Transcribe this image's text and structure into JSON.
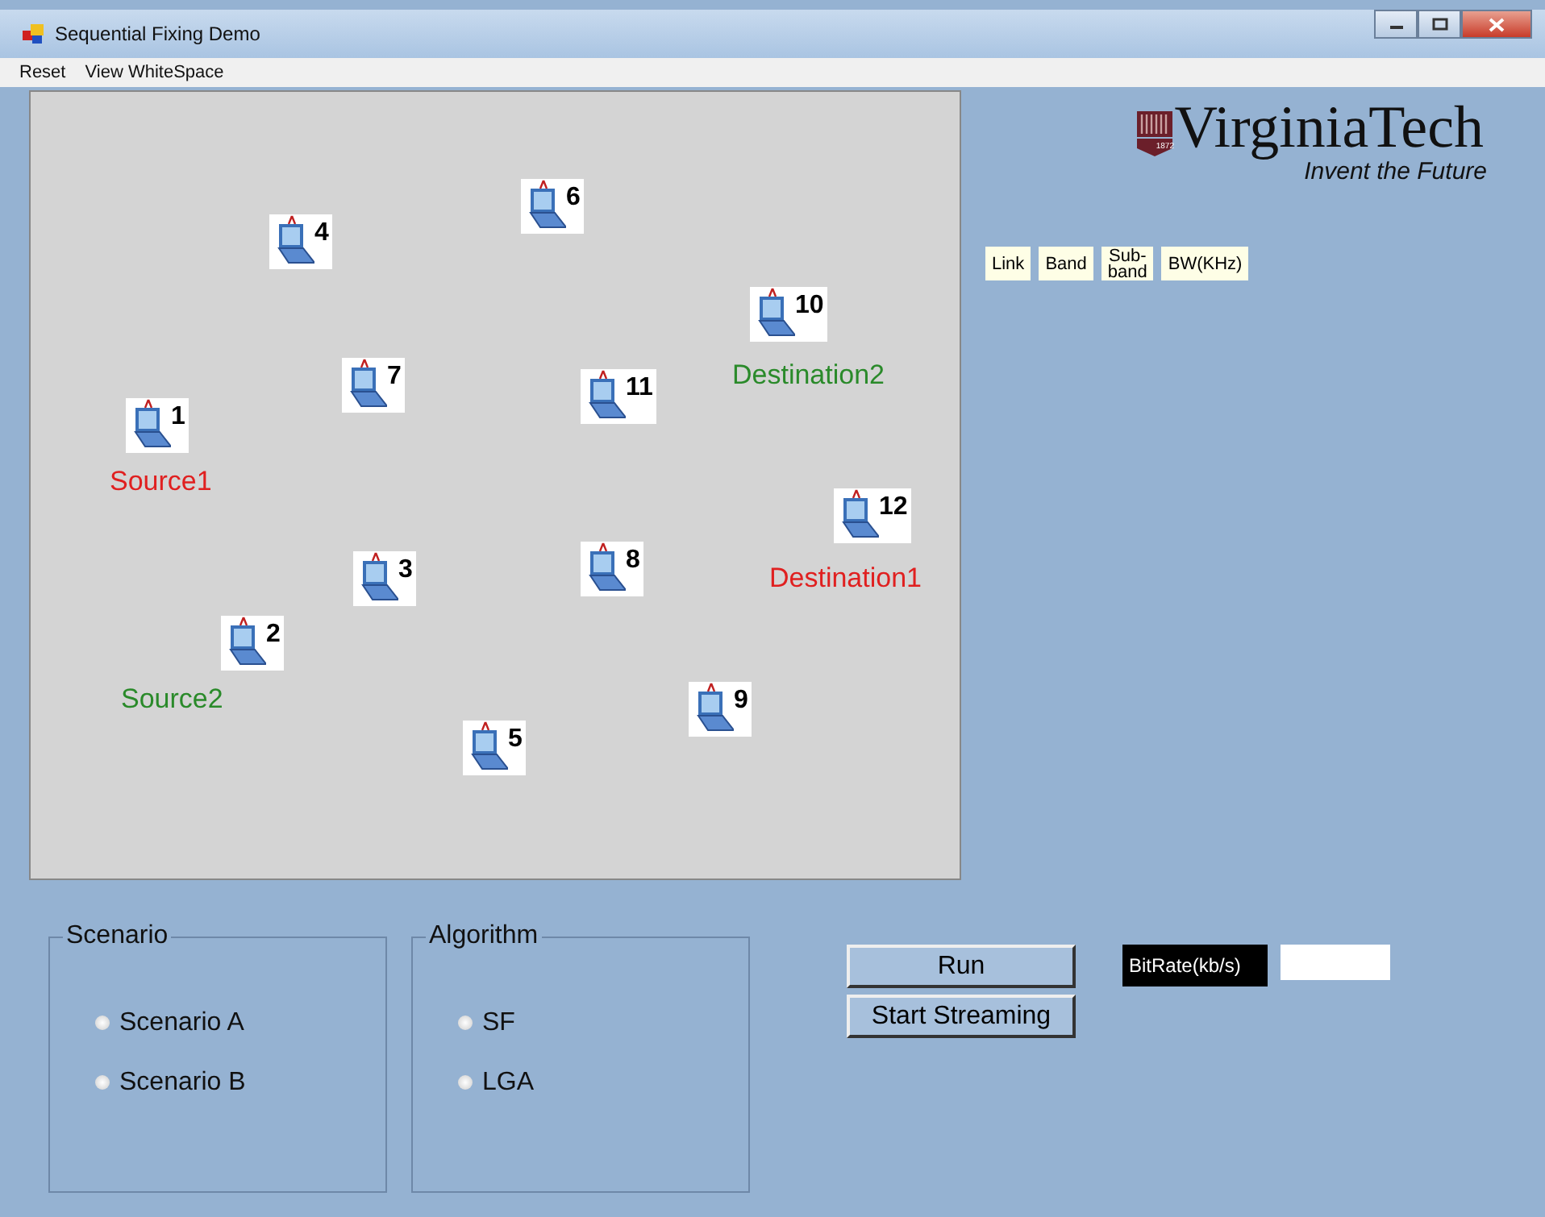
{
  "window": {
    "title": "Sequential Fixing Demo"
  },
  "menu": [
    "Reset",
    "View WhiteSpace"
  ],
  "canvas": {
    "nodes": [
      {
        "label": "1"
      },
      {
        "label": "2"
      },
      {
        "label": "3"
      },
      {
        "label": "4"
      },
      {
        "label": "5"
      },
      {
        "label": "6"
      },
      {
        "label": "7"
      },
      {
        "label": "8"
      },
      {
        "label": "9"
      },
      {
        "label": "10"
      },
      {
        "label": "11"
      },
      {
        "label": "12"
      }
    ],
    "tags": [
      {
        "text": "Source1",
        "color": "#e02020"
      },
      {
        "text": "Source2",
        "color": "#2a8a2a"
      },
      {
        "text": "Destination2",
        "color": "#2a8a2a"
      },
      {
        "text": "Destination1",
        "color": "#e02020"
      }
    ]
  },
  "logo": {
    "name": "VirginiaTech",
    "year": "1872",
    "tagline": "Invent the Future"
  },
  "table": {
    "columns": [
      "Link",
      "Band",
      "Sub-\nband",
      "BW(KHz)"
    ]
  },
  "scenario": {
    "title": "Scenario",
    "options": [
      {
        "label": "Scenario A",
        "selected": false
      },
      {
        "label": "Scenario B",
        "selected": false
      }
    ]
  },
  "algorithm": {
    "title": "Algorithm",
    "options": [
      {
        "label": "SF",
        "selected": false
      },
      {
        "label": "LGA",
        "selected": false
      }
    ]
  },
  "buttons": [
    "Run",
    "Start Streaming"
  ],
  "bitrate": {
    "label": "BitRate(kb/s)"
  }
}
